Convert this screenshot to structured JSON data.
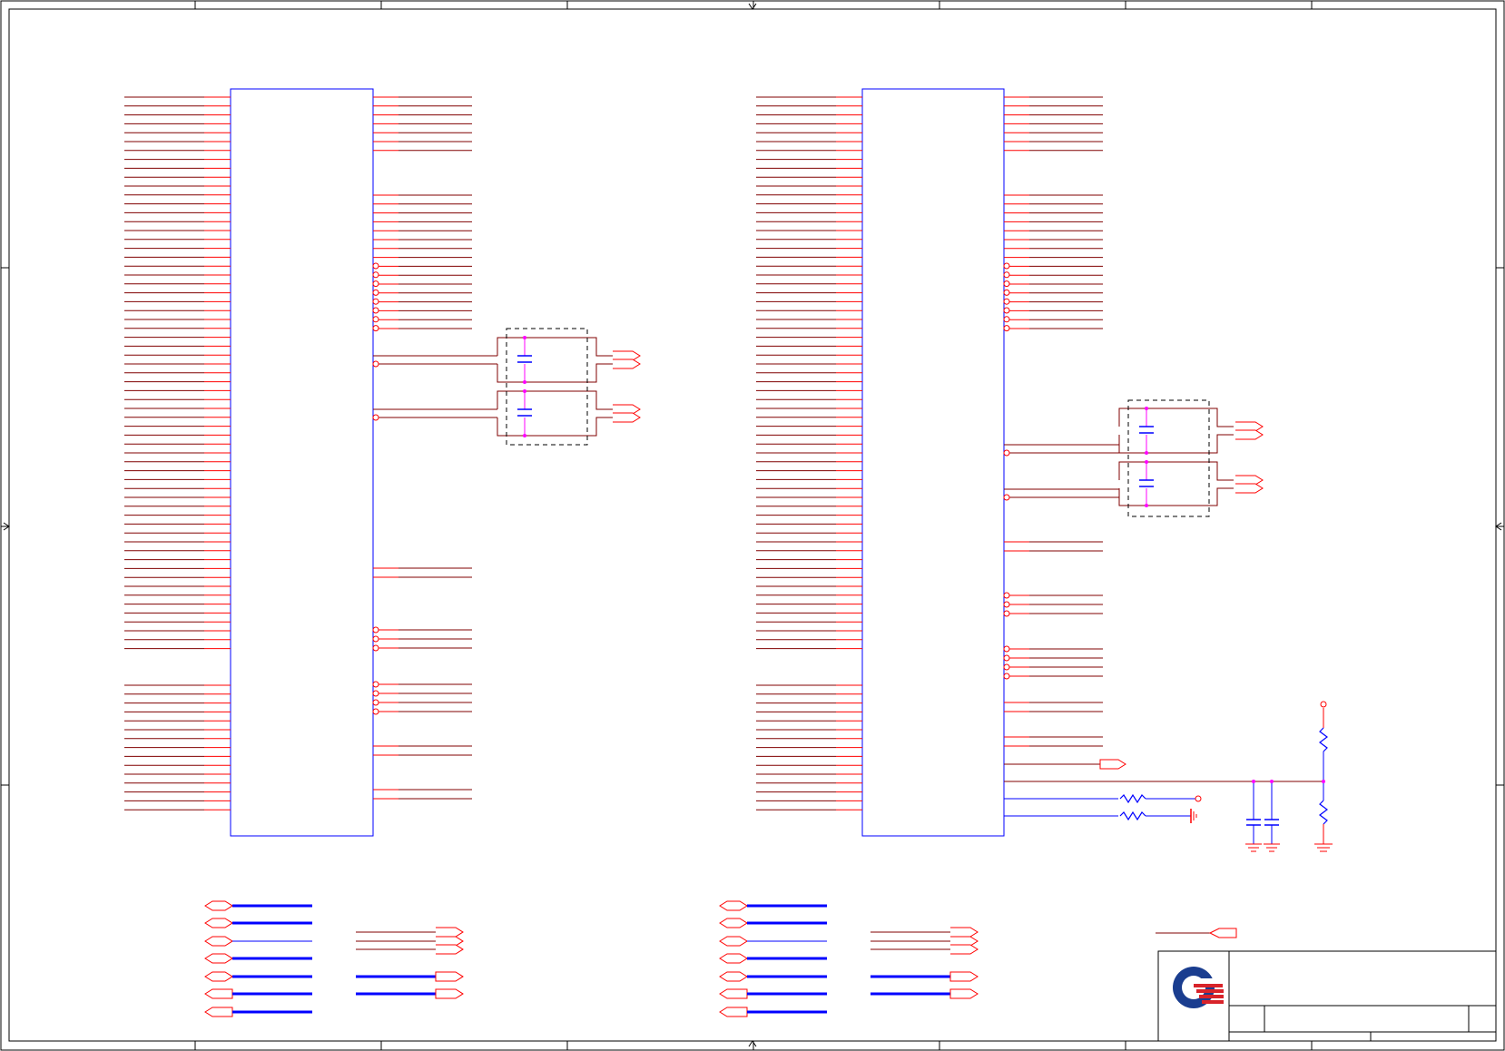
{
  "sheet": {
    "colors": {
      "frame": "#000000",
      "chip_body": "#0000ff",
      "wire": "#800000",
      "pin": "#ff0000",
      "bus": "#0000ff",
      "junction": "#ff00ff",
      "passive": "#0000ff",
      "logo_blue": "#1a3d8f",
      "logo_red": "#d8232a"
    },
    "title_block": {
      "logo": "company-logo",
      "title": "",
      "size": "",
      "document_number": "",
      "revision": "",
      "date": "",
      "sheet_of": ""
    }
  }
}
